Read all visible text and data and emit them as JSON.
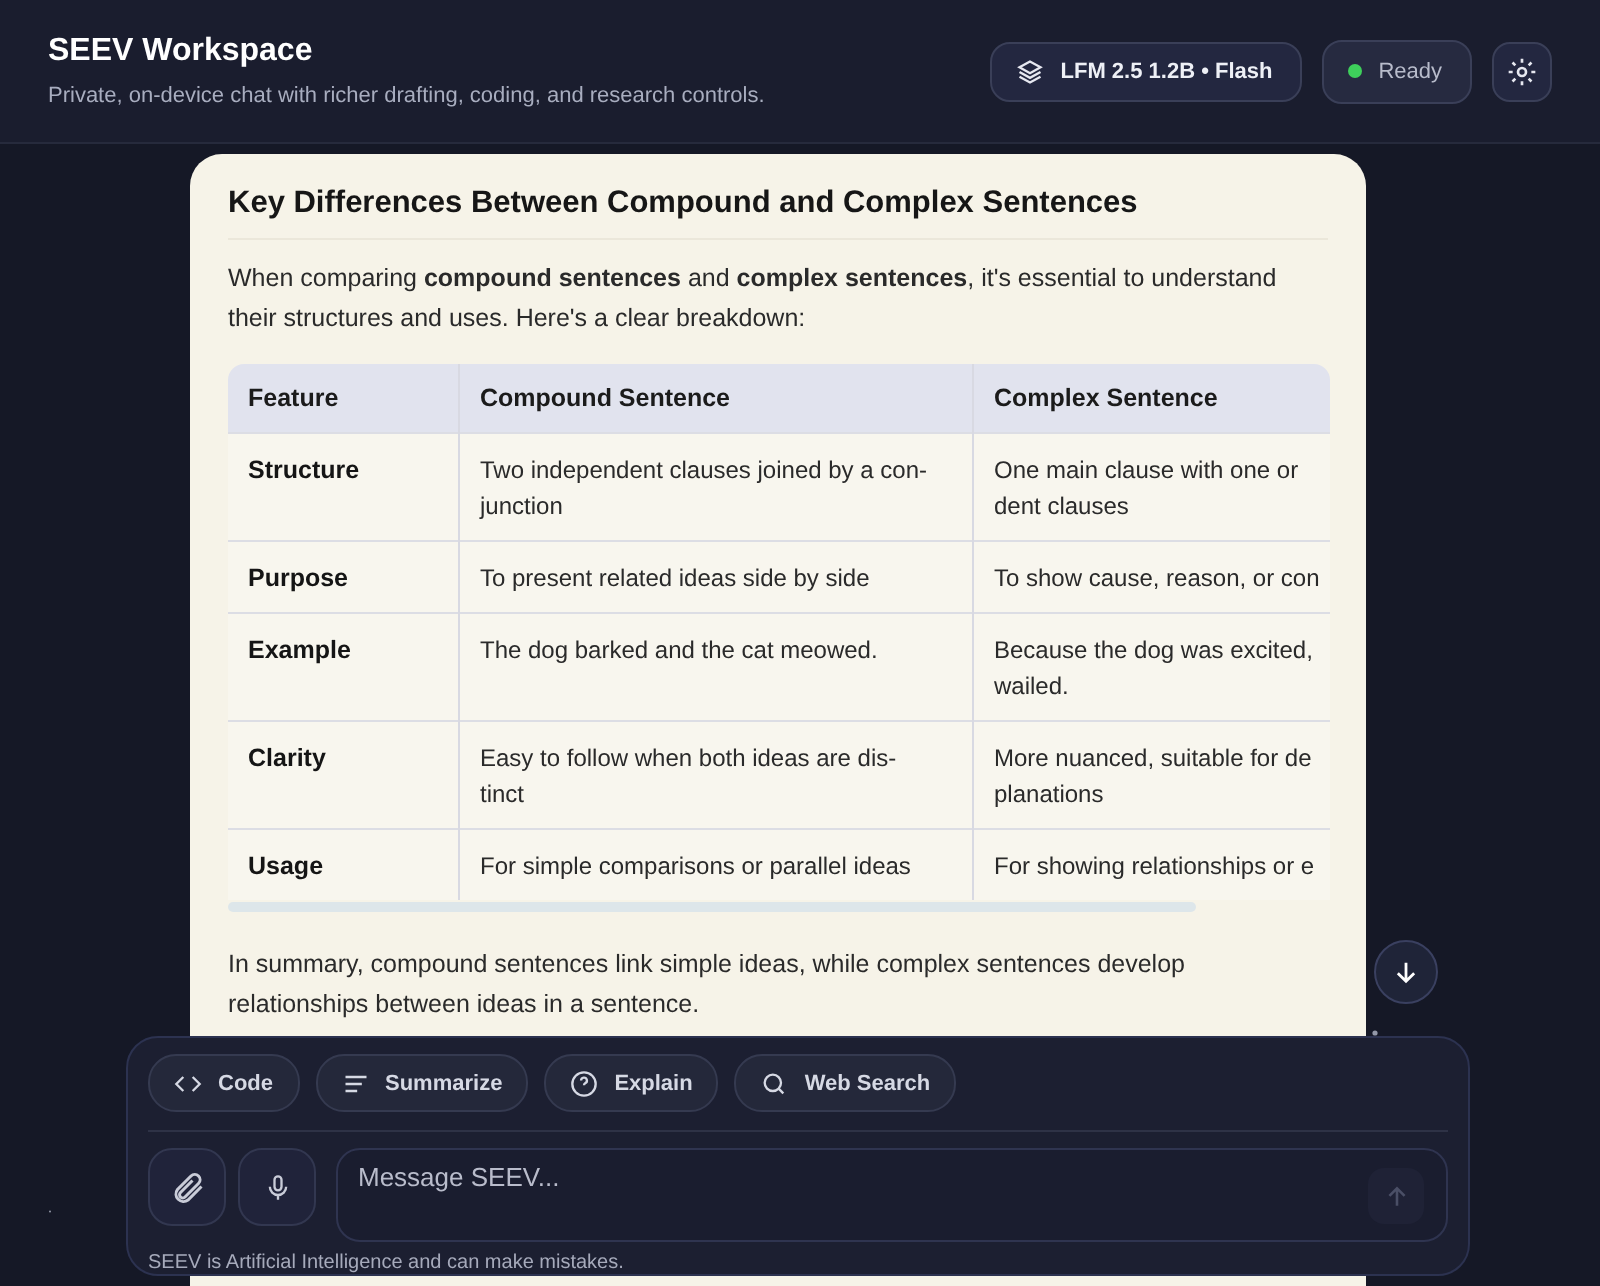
{
  "header": {
    "title": "SEEV Workspace",
    "subtitle": "Private, on-device chat with richer drafting, coding, and research controls.",
    "model": "LFM 2.5 1.2B • Flash",
    "status": {
      "label": "Ready",
      "online": true
    }
  },
  "message": {
    "heading": "Key Differences Between Compound and Complex Sentences",
    "intro": "When comparing **compound sentences** and **complex sentences**, it's essential to understand their structures and uses. Here's a clear breakdown:",
    "table": {
      "columns": [
        "Feature",
        "Compound Sentence",
        "Complex Sentence"
      ],
      "rows": [
        [
          "Structure",
          "Two independent clauses joined by a con-\njunction",
          "One main clause with one or\ndent clauses"
        ],
        [
          "Purpose",
          "To present related ideas side by side",
          "To show cause, reason, or con"
        ],
        [
          "Example",
          "The dog barked and the cat meowed.",
          "Because the dog was excited,\nwailed."
        ],
        [
          "Clarity",
          "Easy to follow when both ideas are dis-\ntinct",
          "More nuanced, suitable for de\nplanations"
        ],
        [
          "Usage",
          "For simple comparisons or parallel ideas",
          "For showing relationships or e"
        ]
      ]
    },
    "summary": "In summary, compound sentences link simple ideas, while complex sentences develop relationships between ideas in a sentence."
  },
  "composer": {
    "actions": [
      {
        "kind": "code",
        "label": "Code"
      },
      {
        "kind": "summarize",
        "label": "Summarize"
      },
      {
        "kind": "explain",
        "label": "Explain"
      },
      {
        "kind": "search",
        "label": "Web Search"
      }
    ],
    "placeholder": "Message SEEV...",
    "send_disabled": true,
    "disclaimer": "SEEV is Artificial Intelligence and can make mistakes."
  }
}
